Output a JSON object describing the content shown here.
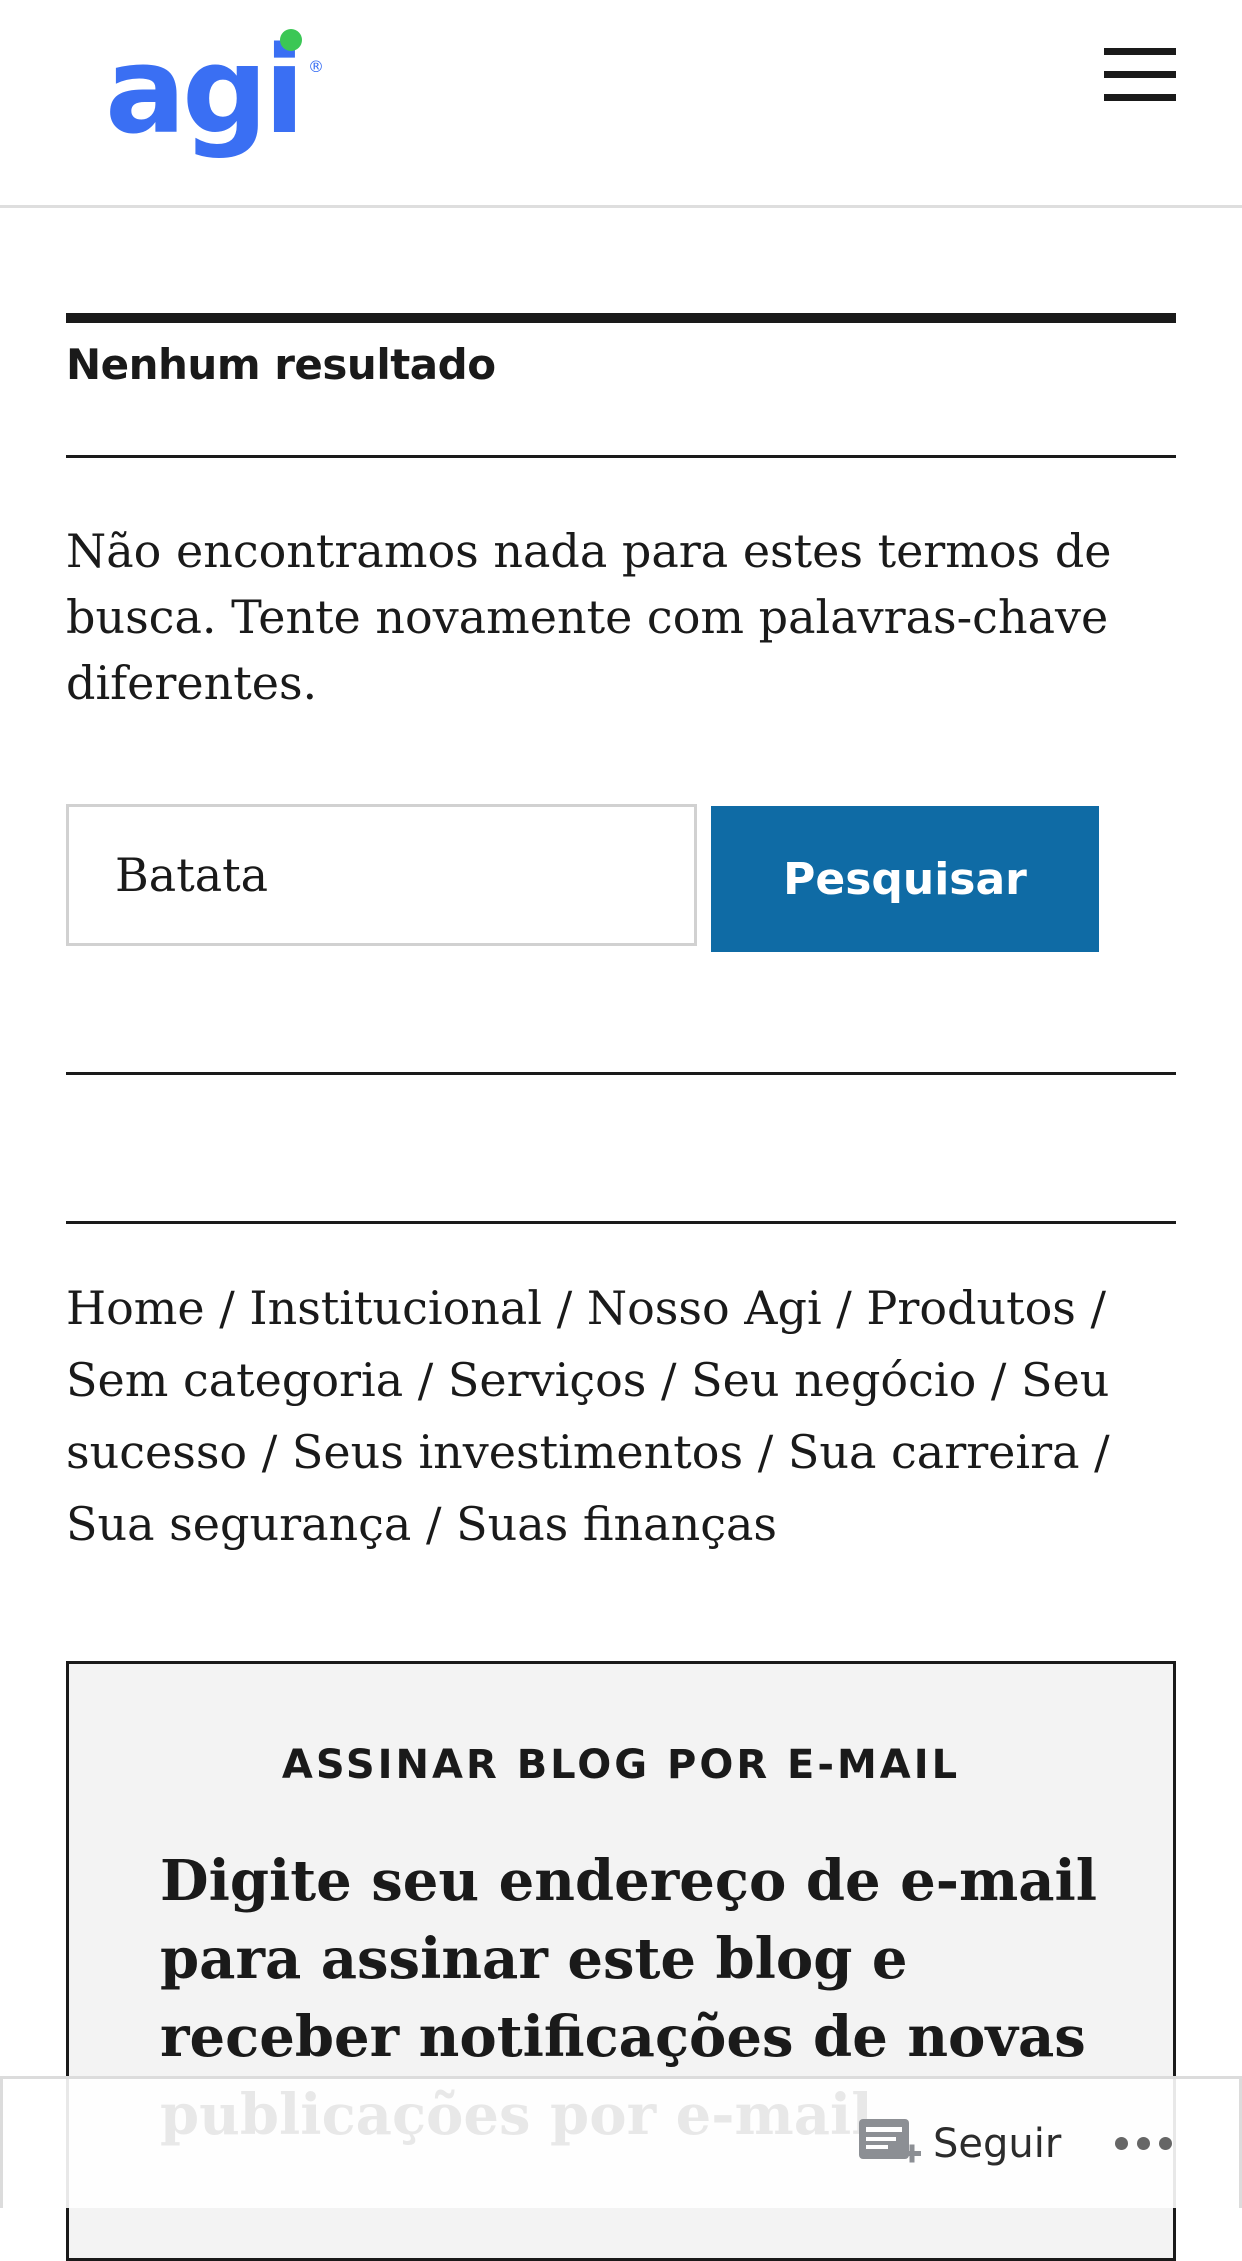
{
  "header": {
    "logo_text": "agi",
    "logo_mark": "®",
    "logo_color": "#3a6ff3",
    "logo_dot_color": "#3bc755",
    "menu_icon": "hamburger-menu-icon"
  },
  "main": {
    "page_title": "Nenhum resultado",
    "message": "Não encontramos nada para estes termos de busca. Tente novamente com palavras-chave diferentes.",
    "search": {
      "value": "Batata",
      "button_label": "Pesquisar",
      "button_color": "#0f6ba5"
    }
  },
  "categories": {
    "items": [
      "Home",
      "Institucional",
      "Nosso Agi",
      "Produtos",
      "Sem categoria",
      "Serviços",
      "Seu negócio",
      "Seu sucesso",
      "Seus investimentos",
      "Sua carreira",
      "Sua segurança",
      "Suas finanças"
    ],
    "separator": "/"
  },
  "subscribe": {
    "title": "ASSINAR BLOG POR E-MAIL",
    "text": "Digite seu endereço de e-mail para assinar este blog e receber notificações de novas publicações por e-mail."
  },
  "follow_bar": {
    "follow_label": "Seguir",
    "follow_icon": "reader-follow-icon",
    "more_icon": "more-horizontal-icon"
  }
}
